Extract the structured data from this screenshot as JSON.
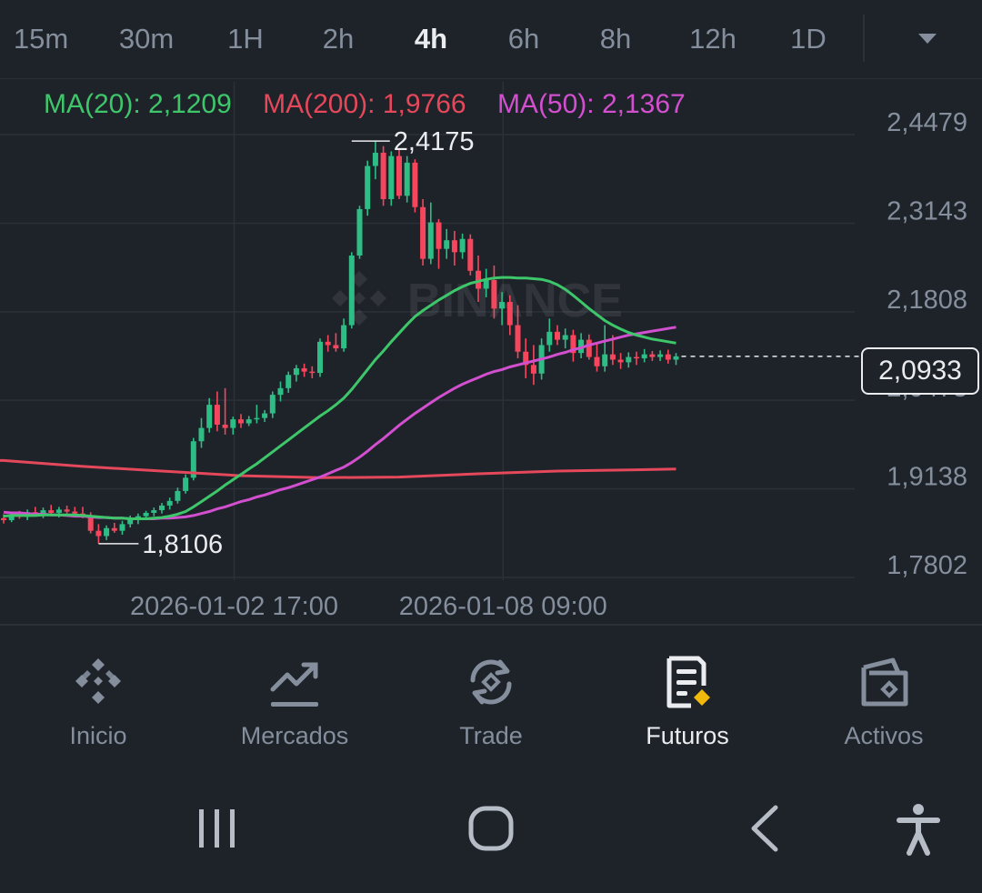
{
  "intervals": [
    {
      "label": "15m",
      "active": false
    },
    {
      "label": "30m",
      "active": false
    },
    {
      "label": "1H",
      "active": false
    },
    {
      "label": "2h",
      "active": false
    },
    {
      "label": "4h",
      "active": true
    },
    {
      "label": "6h",
      "active": false
    },
    {
      "label": "8h",
      "active": false
    },
    {
      "label": "12h",
      "active": false
    },
    {
      "label": "1D",
      "active": false
    }
  ],
  "dropdown_icon": "caret-down-icon",
  "ma_legend": [
    {
      "label": "MA(20): 2,1209",
      "color": "#3ec76a"
    },
    {
      "label": "MA(200): 1,9766",
      "color": "#e4485a"
    },
    {
      "label": "MA(50): 2,1367",
      "color": "#d24fcf"
    }
  ],
  "current_price": "2,0933",
  "watermark": "BINANCE",
  "colors": {
    "up": "#2ebd85",
    "down": "#f6465d",
    "ma20": "#3ec76a",
    "ma200": "#e4485a",
    "ma50": "#d24fcf",
    "background": "#1e2329",
    "grid": "#2b3139",
    "text": "#848e9c",
    "text_active": "#eaecef",
    "accent": "#f0b90b"
  },
  "chart_data": {
    "type": "candlestick",
    "interval": "4h",
    "ylim": [
      1.7802,
      2.4479
    ],
    "y_ticks": [
      "2,4479",
      "2,3143",
      "2,1808",
      "2,0473",
      "1,9138",
      "1,7802"
    ],
    "y_tick_values": [
      2.4479,
      2.3143,
      2.1808,
      2.0473,
      1.9138,
      1.7802
    ],
    "x_ticks": [
      {
        "label": "2026-01-02 17:00",
        "index": 25
      },
      {
        "label": "2026-01-08 09:00",
        "index": 59
      }
    ],
    "high_marker": {
      "label": "2,4175",
      "value": 2.4175,
      "index": 44
    },
    "low_marker": {
      "label": "1,8106",
      "value": 1.8106,
      "index": 12
    },
    "candles": [
      [
        1.849,
        1.855,
        1.841,
        1.846
      ],
      [
        1.846,
        1.858,
        1.843,
        1.854
      ],
      [
        1.854,
        1.86,
        1.848,
        1.851
      ],
      [
        1.851,
        1.862,
        1.846,
        1.858
      ],
      [
        1.858,
        1.866,
        1.852,
        1.855
      ],
      [
        1.855,
        1.865,
        1.849,
        1.861
      ],
      [
        1.861,
        1.869,
        1.853,
        1.857
      ],
      [
        1.857,
        1.866,
        1.85,
        1.862
      ],
      [
        1.862,
        1.868,
        1.856,
        1.859
      ],
      [
        1.859,
        1.866,
        1.851,
        1.856
      ],
      [
        1.856,
        1.866,
        1.849,
        1.853
      ],
      [
        1.853,
        1.858,
        1.826,
        1.83
      ],
      [
        1.83,
        1.84,
        1.811,
        1.822
      ],
      [
        1.822,
        1.838,
        1.816,
        1.834
      ],
      [
        1.834,
        1.842,
        1.827,
        1.83
      ],
      [
        1.83,
        1.845,
        1.824,
        1.84
      ],
      [
        1.84,
        1.853,
        1.835,
        1.848
      ],
      [
        1.848,
        1.856,
        1.84,
        1.852
      ],
      [
        1.852,
        1.86,
        1.846,
        1.857
      ],
      [
        1.857,
        1.865,
        1.852,
        1.861
      ],
      [
        1.861,
        1.872,
        1.856,
        1.868
      ],
      [
        1.868,
        1.88,
        1.862,
        1.875
      ],
      [
        1.875,
        1.895,
        1.871,
        1.89
      ],
      [
        1.89,
        1.915,
        1.886,
        1.91
      ],
      [
        1.91,
        1.97,
        1.906,
        1.965
      ],
      [
        1.965,
        2.0,
        1.955,
        1.985
      ],
      [
        1.985,
        2.03,
        1.978,
        2.02
      ],
      [
        2.02,
        2.04,
        1.98,
        1.99
      ],
      [
        1.99,
        2.045,
        1.975,
        1.985
      ],
      [
        1.985,
        2.002,
        1.975,
        1.998
      ],
      [
        1.998,
        2.006,
        1.985,
        1.992
      ],
      [
        1.992,
        2.003,
        1.988,
        1.998
      ],
      [
        1.998,
        2.02,
        1.992,
        2.0
      ],
      [
        2.0,
        2.012,
        1.994,
        2.007
      ],
      [
        2.007,
        2.04,
        2.0,
        2.035
      ],
      [
        2.035,
        2.055,
        2.025,
        2.045
      ],
      [
        2.045,
        2.07,
        2.038,
        2.065
      ],
      [
        2.065,
        2.08,
        2.055,
        2.075
      ],
      [
        2.075,
        2.082,
        2.062,
        2.07
      ],
      [
        2.07,
        2.078,
        2.06,
        2.068
      ],
      [
        2.068,
        2.12,
        2.062,
        2.115
      ],
      [
        2.115,
        2.125,
        2.1,
        2.11
      ],
      [
        2.11,
        2.128,
        2.1,
        2.105
      ],
      [
        2.105,
        2.15,
        2.1,
        2.14
      ],
      [
        2.14,
        2.25,
        2.135,
        2.245
      ],
      [
        2.245,
        2.32,
        2.24,
        2.315
      ],
      [
        2.315,
        2.388,
        2.305,
        2.38
      ],
      [
        2.38,
        2.418,
        2.36,
        2.4
      ],
      [
        2.4,
        2.41,
        2.32,
        2.33
      ],
      [
        2.33,
        2.402,
        2.32,
        2.395
      ],
      [
        2.395,
        2.405,
        2.33,
        2.335
      ],
      [
        2.335,
        2.395,
        2.325,
        2.385
      ],
      [
        2.385,
        2.39,
        2.31,
        2.318
      ],
      [
        2.318,
        2.33,
        2.23,
        2.24
      ],
      [
        2.24,
        2.325,
        2.232,
        2.295
      ],
      [
        2.295,
        2.3,
        2.225,
        2.255
      ],
      [
        2.255,
        2.285,
        2.24,
        2.268
      ],
      [
        2.268,
        2.282,
        2.23,
        2.25
      ],
      [
        2.25,
        2.278,
        2.24,
        2.27
      ],
      [
        2.27,
        2.277,
        2.215,
        2.222
      ],
      [
        2.222,
        2.245,
        2.175,
        2.195
      ],
      [
        2.195,
        2.225,
        2.182,
        2.208
      ],
      [
        2.208,
        2.23,
        2.15,
        2.165
      ],
      [
        2.165,
        2.19,
        2.14,
        2.175
      ],
      [
        2.175,
        2.185,
        2.125,
        2.14
      ],
      [
        2.14,
        2.17,
        2.09,
        2.1
      ],
      [
        2.1,
        2.12,
        2.06,
        2.08
      ],
      [
        2.08,
        2.11,
        2.05,
        2.067
      ],
      [
        2.067,
        2.12,
        2.058,
        2.11
      ],
      [
        2.11,
        2.15,
        2.1,
        2.13
      ],
      [
        2.13,
        2.14,
        2.11,
        2.118
      ],
      [
        2.118,
        2.135,
        2.105,
        2.125
      ],
      [
        2.125,
        2.133,
        2.085,
        2.098
      ],
      [
        2.098,
        2.128,
        2.09,
        2.118
      ],
      [
        2.118,
        2.126,
        2.088,
        2.092
      ],
      [
        2.092,
        2.112,
        2.07,
        2.078
      ],
      [
        2.078,
        2.14,
        2.07,
        2.096
      ],
      [
        2.096,
        2.125,
        2.08,
        2.088
      ],
      [
        2.088,
        2.098,
        2.074,
        2.084
      ],
      [
        2.084,
        2.099,
        2.076,
        2.092
      ],
      [
        2.092,
        2.1,
        2.08,
        2.09
      ],
      [
        2.09,
        2.104,
        2.084,
        2.096
      ],
      [
        2.096,
        2.101,
        2.086,
        2.092
      ],
      [
        2.092,
        2.102,
        2.086,
        2.096
      ],
      [
        2.096,
        2.103,
        2.082,
        2.088
      ],
      [
        2.088,
        2.098,
        2.08,
        2.093
      ]
    ],
    "ma20": [
      1.852,
      1.853,
      1.853,
      1.853,
      1.853,
      1.854,
      1.854,
      1.854,
      1.854,
      1.854,
      1.853,
      1.852,
      1.851,
      1.85,
      1.849,
      1.849,
      1.848,
      1.848,
      1.848,
      1.849,
      1.85,
      1.852,
      1.855,
      1.859,
      1.866,
      1.874,
      1.882,
      1.89,
      1.899,
      1.907,
      1.915,
      1.923,
      1.931,
      1.94,
      1.949,
      1.958,
      1.967,
      1.976,
      1.985,
      1.994,
      2.003,
      2.011,
      2.02,
      2.03,
      2.043,
      2.058,
      2.073,
      2.088,
      2.101,
      2.115,
      2.128,
      2.141,
      2.153,
      2.162,
      2.17,
      2.178,
      2.185,
      2.192,
      2.198,
      2.203,
      2.206,
      2.209,
      2.211,
      2.212,
      2.212,
      2.211,
      2.211,
      2.21,
      2.209,
      2.206,
      2.201,
      2.194,
      2.185,
      2.175,
      2.165,
      2.156,
      2.147,
      2.14,
      2.134,
      2.129,
      2.125,
      2.122,
      2.119,
      2.117,
      2.115,
      2.113
    ],
    "ma50": [
      1.858,
      1.857,
      1.857,
      1.856,
      1.855,
      1.855,
      1.854,
      1.854,
      1.853,
      1.852,
      1.852,
      1.851,
      1.85,
      1.85,
      1.849,
      1.849,
      1.848,
      1.848,
      1.848,
      1.848,
      1.849,
      1.849,
      1.85,
      1.851,
      1.853,
      1.856,
      1.859,
      1.863,
      1.866,
      1.87,
      1.874,
      1.877,
      1.881,
      1.884,
      1.888,
      1.892,
      1.895,
      1.899,
      1.903,
      1.907,
      1.911,
      1.916,
      1.921,
      1.926,
      1.933,
      1.941,
      1.95,
      1.96,
      1.969,
      1.979,
      1.989,
      1.998,
      2.007,
      2.015,
      2.023,
      2.031,
      2.038,
      2.045,
      2.051,
      2.056,
      2.061,
      2.066,
      2.07,
      2.073,
      2.077,
      2.08,
      2.083,
      2.086,
      2.089,
      2.092,
      2.096,
      2.099,
      2.103,
      2.106,
      2.11,
      2.113,
      2.116,
      2.119,
      2.122,
      2.125,
      2.127,
      2.129,
      2.131,
      2.133,
      2.135,
      2.137
    ],
    "ma200_points": [
      [
        -22,
        1.94
      ],
      [
        0,
        1.936
      ],
      [
        10,
        1.927
      ],
      [
        20,
        1.92
      ],
      [
        30,
        1.913
      ],
      [
        40,
        1.91
      ],
      [
        50,
        1.911
      ],
      [
        60,
        1.916
      ],
      [
        70,
        1.92
      ],
      [
        80,
        1.922
      ],
      [
        85,
        1.923
      ]
    ]
  },
  "bottom_nav": [
    {
      "label": "Inicio",
      "icon": "binance-logo-icon",
      "active": false
    },
    {
      "label": "Mercados",
      "icon": "chart-trend-icon",
      "active": false
    },
    {
      "label": "Trade",
      "icon": "trade-swap-icon",
      "active": false
    },
    {
      "label": "Futuros",
      "icon": "futures-document-icon",
      "active": true
    },
    {
      "label": "Activos",
      "icon": "wallet-icon",
      "active": false
    }
  ],
  "system_nav": [
    "recent-apps-icon",
    "home-icon",
    "back-icon",
    "accessibility-icon"
  ]
}
